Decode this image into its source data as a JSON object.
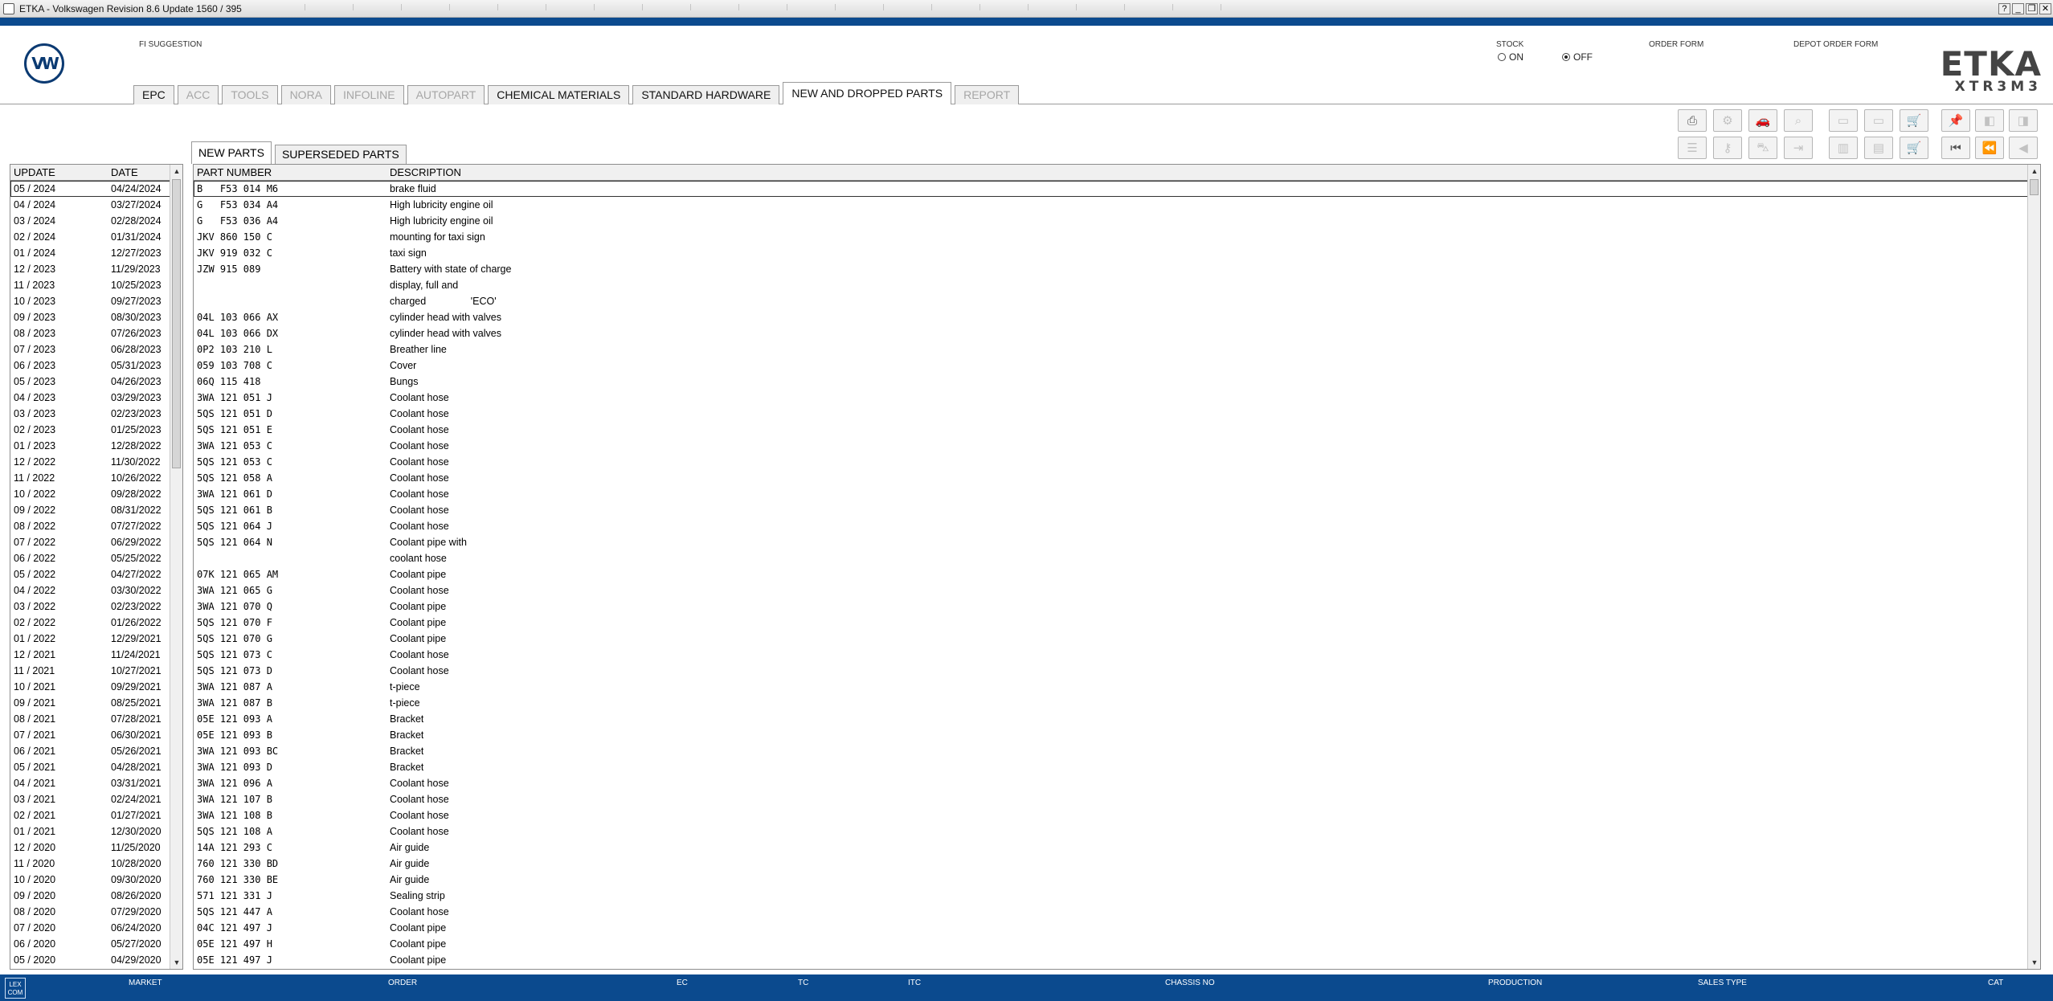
{
  "window": {
    "title": "ETKA - Volkswagen Revision 8.6 Update 1560 / 395"
  },
  "brand": {
    "logo_text": "VW",
    "name": "ETKA",
    "sub": "XTR3M3"
  },
  "header": {
    "fi_suggestion": "FI SUGGESTION",
    "stock_label": "STOCK",
    "stock_on": "ON",
    "stock_off": "OFF",
    "stock_selected": "OFF",
    "order_form": "ORDER FORM",
    "depot_order_form": "DEPOT ORDER FORM"
  },
  "tabs": [
    {
      "label": "EPC",
      "state": "normal"
    },
    {
      "label": "ACC",
      "state": "disabled"
    },
    {
      "label": "TOOLS",
      "state": "disabled"
    },
    {
      "label": "NORA",
      "state": "disabled"
    },
    {
      "label": "INFOLINE",
      "state": "disabled"
    },
    {
      "label": "AUTOPART",
      "state": "disabled"
    },
    {
      "label": "CHEMICAL MATERIALS",
      "state": "normal"
    },
    {
      "label": "STANDARD HARDWARE",
      "state": "normal"
    },
    {
      "label": "NEW AND DROPPED PARTS",
      "state": "active"
    },
    {
      "label": "REPORT",
      "state": "disabled"
    }
  ],
  "subtabs": [
    {
      "label": "NEW PARTS",
      "state": "active"
    },
    {
      "label": "SUPERSEDED PARTS",
      "state": "normal"
    }
  ],
  "update_list": {
    "headers": {
      "update": "UPDATE",
      "date": "DATE"
    },
    "rows": [
      [
        "05 / 2024",
        "04/24/2024"
      ],
      [
        "04 / 2024",
        "03/27/2024"
      ],
      [
        "03 / 2024",
        "02/28/2024"
      ],
      [
        "02 / 2024",
        "01/31/2024"
      ],
      [
        "01 / 2024",
        "12/27/2023"
      ],
      [
        "12 / 2023",
        "11/29/2023"
      ],
      [
        "11 / 2023",
        "10/25/2023"
      ],
      [
        "10 / 2023",
        "09/27/2023"
      ],
      [
        "09 / 2023",
        "08/30/2023"
      ],
      [
        "08 / 2023",
        "07/26/2023"
      ],
      [
        "07 / 2023",
        "06/28/2023"
      ],
      [
        "06 / 2023",
        "05/31/2023"
      ],
      [
        "05 / 2023",
        "04/26/2023"
      ],
      [
        "04 / 2023",
        "03/29/2023"
      ],
      [
        "03 / 2023",
        "02/23/2023"
      ],
      [
        "02 / 2023",
        "01/25/2023"
      ],
      [
        "01 / 2023",
        "12/28/2022"
      ],
      [
        "12 / 2022",
        "11/30/2022"
      ],
      [
        "11 / 2022",
        "10/26/2022"
      ],
      [
        "10 / 2022",
        "09/28/2022"
      ],
      [
        "09 / 2022",
        "08/31/2022"
      ],
      [
        "08 / 2022",
        "07/27/2022"
      ],
      [
        "07 / 2022",
        "06/29/2022"
      ],
      [
        "06 / 2022",
        "05/25/2022"
      ],
      [
        "05 / 2022",
        "04/27/2022"
      ],
      [
        "04 / 2022",
        "03/30/2022"
      ],
      [
        "03 / 2022",
        "02/23/2022"
      ],
      [
        "02 / 2022",
        "01/26/2022"
      ],
      [
        "01 / 2022",
        "12/29/2021"
      ],
      [
        "12 / 2021",
        "11/24/2021"
      ],
      [
        "11 / 2021",
        "10/27/2021"
      ],
      [
        "10 / 2021",
        "09/29/2021"
      ],
      [
        "09 / 2021",
        "08/25/2021"
      ],
      [
        "08 / 2021",
        "07/28/2021"
      ],
      [
        "07 / 2021",
        "06/30/2021"
      ],
      [
        "06 / 2021",
        "05/26/2021"
      ],
      [
        "05 / 2021",
        "04/28/2021"
      ],
      [
        "04 / 2021",
        "03/31/2021"
      ],
      [
        "03 / 2021",
        "02/24/2021"
      ],
      [
        "02 / 2021",
        "01/27/2021"
      ],
      [
        "01 / 2021",
        "12/30/2020"
      ],
      [
        "12 / 2020",
        "11/25/2020"
      ],
      [
        "11 / 2020",
        "10/28/2020"
      ],
      [
        "10 / 2020",
        "09/30/2020"
      ],
      [
        "09 / 2020",
        "08/26/2020"
      ],
      [
        "08 / 2020",
        "07/29/2020"
      ],
      [
        "07 / 2020",
        "06/24/2020"
      ],
      [
        "06 / 2020",
        "05/27/2020"
      ],
      [
        "05 / 2020",
        "04/29/2020"
      ]
    ]
  },
  "parts_table": {
    "headers": {
      "part_number": "PART NUMBER",
      "description": "DESCRIPTION"
    },
    "rows": [
      [
        "B   F53 014 M6",
        "brake fluid"
      ],
      [
        "G   F53 034 A4",
        "High lubricity engine oil"
      ],
      [
        "G   F53 036 A4",
        "High lubricity engine oil"
      ],
      [
        "JKV 860 150 C",
        "mounting for taxi sign"
      ],
      [
        "JKV 919 032 C",
        "taxi sign"
      ],
      [
        "JZW 915 089",
        "Battery with state of charge"
      ],
      [
        "",
        "display, full and"
      ],
      [
        "",
        "charged                'ECO'"
      ],
      [
        "04L 103 066 AX",
        "cylinder head with valves"
      ],
      [
        "04L 103 066 DX",
        "cylinder head with valves"
      ],
      [
        "0P2 103 210 L",
        "Breather line"
      ],
      [
        "059 103 708 C",
        "Cover"
      ],
      [
        "06Q 115 418",
        "Bungs"
      ],
      [
        "3WA 121 051 J",
        "Coolant hose"
      ],
      [
        "5QS 121 051 D",
        "Coolant hose"
      ],
      [
        "5QS 121 051 E",
        "Coolant hose"
      ],
      [
        "3WA 121 053 C",
        "Coolant hose"
      ],
      [
        "5QS 121 053 C",
        "Coolant hose"
      ],
      [
        "5QS 121 058 A",
        "Coolant hose"
      ],
      [
        "3WA 121 061 D",
        "Coolant hose"
      ],
      [
        "5QS 121 061 B",
        "Coolant hose"
      ],
      [
        "5QS 121 064 J",
        "Coolant hose"
      ],
      [
        "5QS 121 064 N",
        "Coolant pipe with"
      ],
      [
        "",
        "coolant hose"
      ],
      [
        "07K 121 065 AM",
        "Coolant pipe"
      ],
      [
        "3WA 121 065 G",
        "Coolant hose"
      ],
      [
        "3WA 121 070 Q",
        "Coolant pipe"
      ],
      [
        "5QS 121 070 F",
        "Coolant pipe"
      ],
      [
        "5QS 121 070 G",
        "Coolant pipe"
      ],
      [
        "5QS 121 073 C",
        "Coolant hose"
      ],
      [
        "5QS 121 073 D",
        "Coolant hose"
      ],
      [
        "3WA 121 087 A",
        "t-piece"
      ],
      [
        "3WA 121 087 B",
        "t-piece"
      ],
      [
        "05E 121 093 A",
        "Bracket"
      ],
      [
        "05E 121 093 B",
        "Bracket"
      ],
      [
        "3WA 121 093 BC",
        "Bracket"
      ],
      [
        "3WA 121 093 D",
        "Bracket"
      ],
      [
        "3WA 121 096 A",
        "Coolant hose"
      ],
      [
        "3WA 121 107 B",
        "Coolant hose"
      ],
      [
        "3WA 121 108 B",
        "Coolant hose"
      ],
      [
        "5QS 121 108 A",
        "Coolant hose"
      ],
      [
        "14A 121 293 C",
        "Air guide"
      ],
      [
        "760 121 330 BD",
        "Air guide"
      ],
      [
        "760 121 330 BE",
        "Air guide"
      ],
      [
        "571 121 331 J",
        "Sealing strip"
      ],
      [
        "5QS 121 447 A",
        "Coolant hose"
      ],
      [
        "04C 121 497 J",
        "Coolant pipe"
      ],
      [
        "05E 121 497 H",
        "Coolant pipe"
      ],
      [
        "05E 121 497 J",
        "Coolant pipe"
      ]
    ]
  },
  "statusbar": {
    "logo_text": "LEX COM",
    "labels": [
      "MARKET",
      "ORDER",
      "EC",
      "TC",
      "ITC",
      "CHASSIS NO",
      "PRODUCTION",
      "SALES TYPE",
      "CAT"
    ]
  },
  "colors": {
    "accent": "#0b4a8e",
    "logo": "#0b3a72",
    "panel": "#f0f0f0"
  },
  "toolbar_icons": [
    "printer-icon",
    "stamp-icon",
    "car-icon",
    "search-car-icon",
    "monitor-icon",
    "monitor-off-icon",
    "cart-add-icon",
    "pin-icon",
    "window-prev-icon",
    "window-next-icon",
    "list-icon",
    "key-icon",
    "car-outline-icon",
    "arrow-line-icon",
    "doc-split-icon",
    "doc-copy-icon",
    "cart-icon",
    "first-icon",
    "prev-page-icon",
    "prev-icon"
  ]
}
